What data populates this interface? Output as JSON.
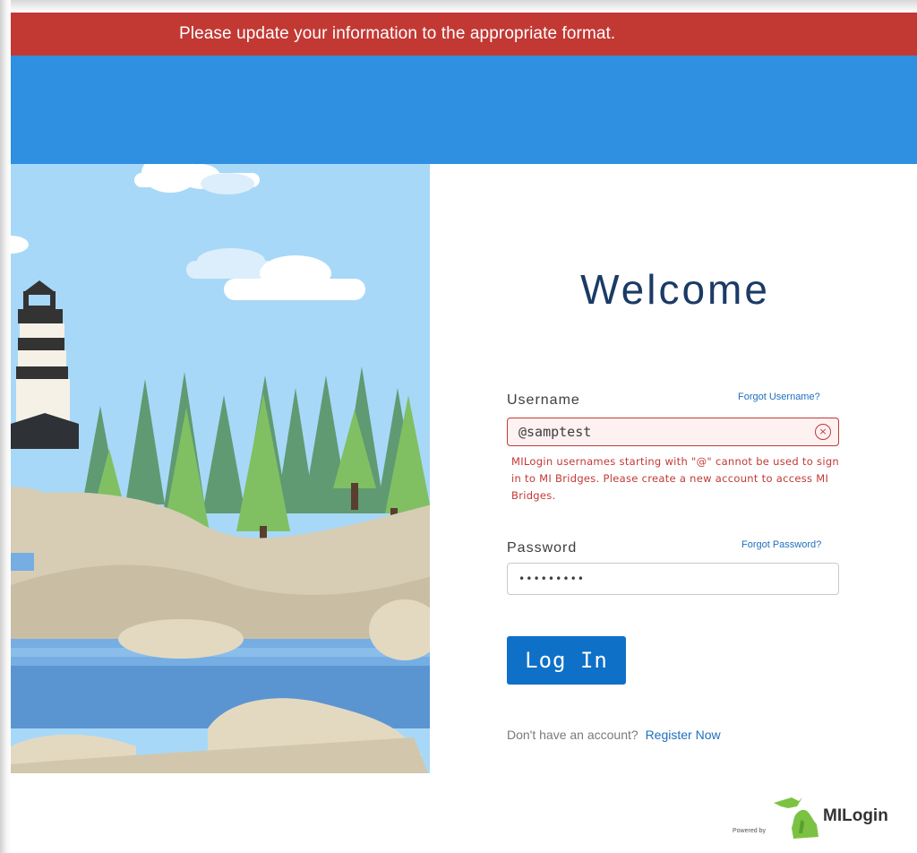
{
  "alert": {
    "message": "Please update your information to the appropriate format."
  },
  "login": {
    "title": "Welcome",
    "username": {
      "label": "Username",
      "forgot_link": "Forgot Username?",
      "value": "@samptest",
      "clear_icon": "×",
      "error": "MILogin usernames starting with \"@\" cannot be used to sign in to MI Bridges. Please create a new account to access MI Bridges."
    },
    "password": {
      "label": "Password",
      "forgot_link": "Forgot Password?",
      "value": "•••••••••"
    },
    "submit_label": "Log In",
    "register": {
      "prompt": "Don't have an account?",
      "link": "Register Now"
    }
  },
  "footer": {
    "powered_by": "Powered by",
    "brand": "MILogin"
  },
  "colors": {
    "alert_red": "#c23934",
    "header_blue": "#2f8fe0",
    "button_blue": "#0f70c8",
    "link_blue": "#1f6fbf",
    "title_navy": "#1b3a66"
  },
  "icons": [
    "lighthouse-illustration",
    "tree-illustration",
    "cloud-illustration",
    "michigan-map-icon",
    "clear-icon"
  ]
}
